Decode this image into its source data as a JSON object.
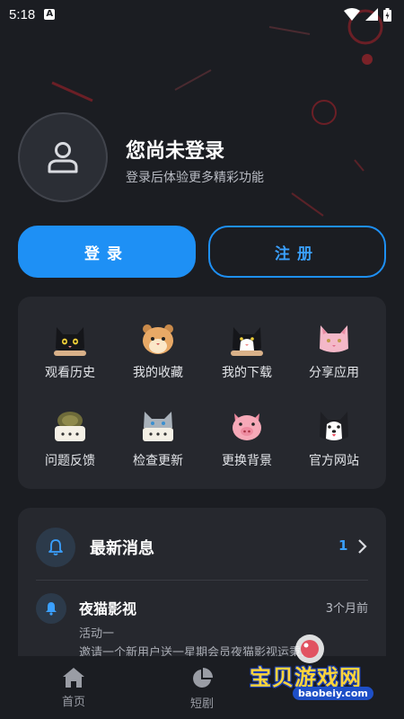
{
  "status_bar": {
    "time": "5:18",
    "notification_badge": "A"
  },
  "profile": {
    "title": "您尚未登录",
    "subtitle": "登录后体验更多精彩功能"
  },
  "auth": {
    "login_label": "登录",
    "register_label": "注册"
  },
  "features": [
    {
      "label": "观看历史",
      "icon": "black-cat-icon"
    },
    {
      "label": "我的收藏",
      "icon": "hamster-icon"
    },
    {
      "label": "我的下载",
      "icon": "tuxedo-cat-icon"
    },
    {
      "label": "分享应用",
      "icon": "pink-cat-icon"
    },
    {
      "label": "问题反馈",
      "icon": "turtle-icon"
    },
    {
      "label": "检查更新",
      "icon": "gray-cat-icon"
    },
    {
      "label": "更换背景",
      "icon": "pig-icon"
    },
    {
      "label": "官方网站",
      "icon": "husky-icon"
    }
  ],
  "messages": {
    "title": "最新消息",
    "count": "1",
    "items": [
      {
        "title": "夜猫影视",
        "time": "3个月前",
        "line1": "活动一",
        "line2": "邀请一个新用户送一星期会员夜猫影视运秉…"
      }
    ]
  },
  "bottom_nav": [
    {
      "label": "首页",
      "icon": "home-icon"
    },
    {
      "label": "短剧",
      "icon": "pie-chart-icon"
    }
  ],
  "watermark": {
    "text": "宝贝游戏网",
    "url": "baobeiy.com"
  },
  "colors": {
    "accent": "#1e90f5",
    "background": "#1b1d22",
    "card": "#26282e"
  }
}
